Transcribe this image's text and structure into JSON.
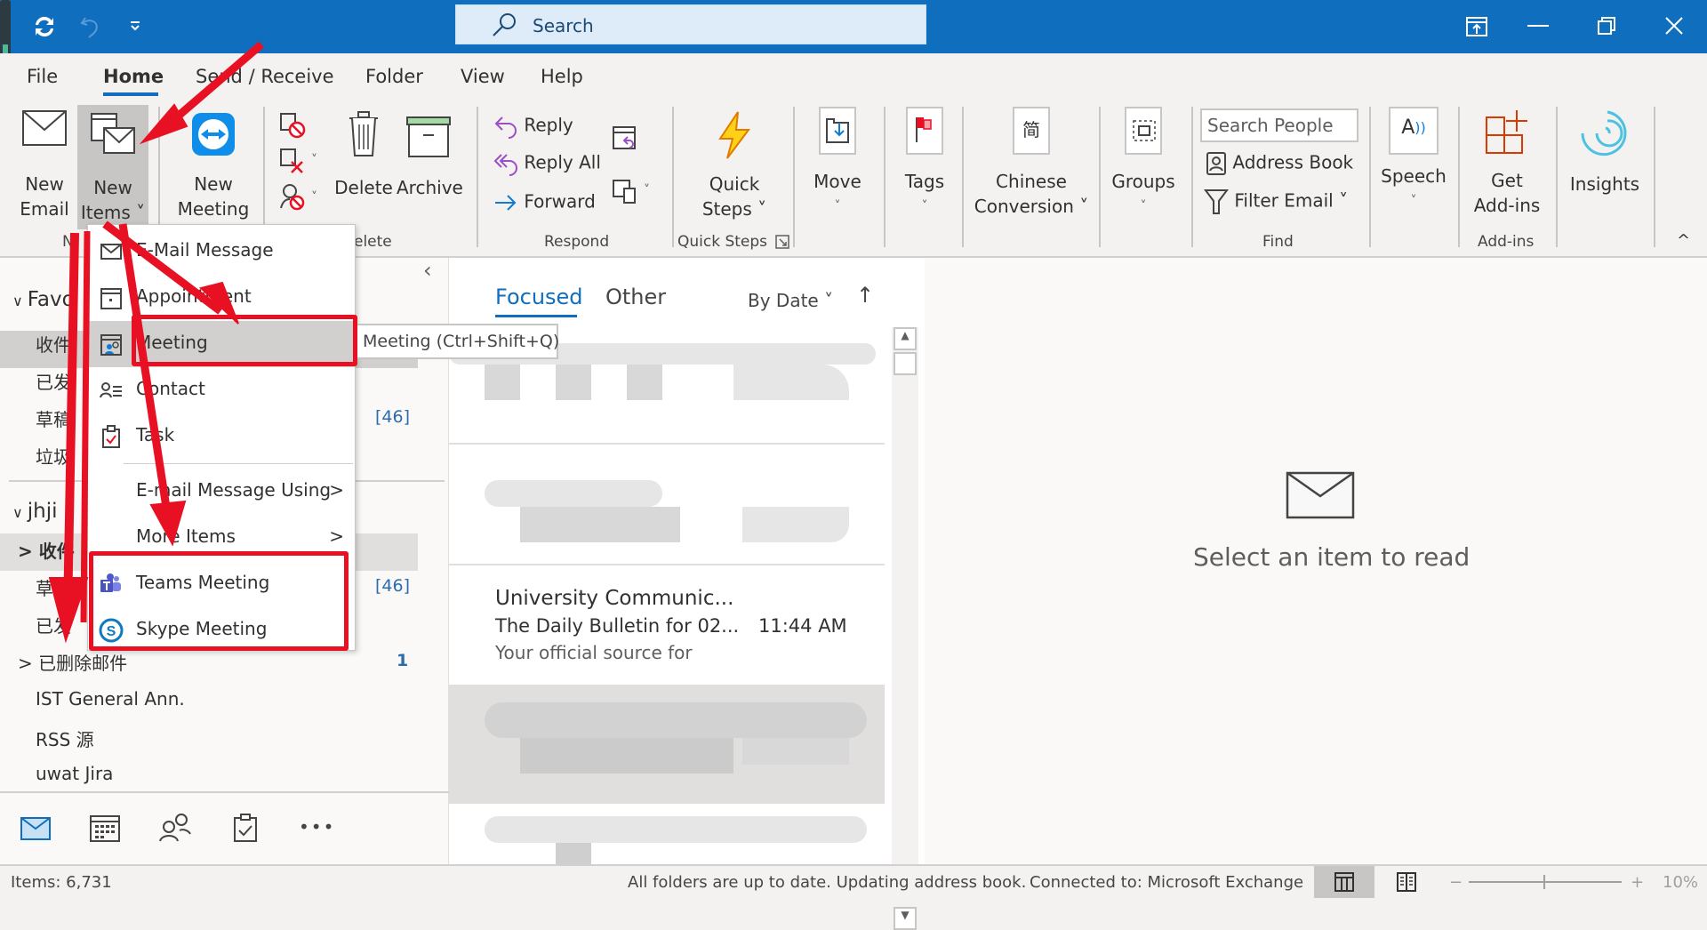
{
  "titlebar": {
    "search_placeholder": "Search",
    "quick_access": [
      "sync-icon",
      "undo-icon",
      "customize-icon"
    ],
    "window_controls": [
      "ribbon-display-icon",
      "minimize-icon",
      "restore-icon",
      "close-icon"
    ]
  },
  "tabs": [
    {
      "label": "File"
    },
    {
      "label": "Home",
      "active": true
    },
    {
      "label": "Send / Receive"
    },
    {
      "label": "Folder"
    },
    {
      "label": "View"
    },
    {
      "label": "Help"
    }
  ],
  "ribbon": {
    "new_email": [
      "New",
      "Email"
    ],
    "new_items": [
      "New",
      "Items ˅"
    ],
    "new_meeting": [
      "New",
      "Meeting"
    ],
    "delete": "Delete",
    "archive": "Archive",
    "reply": "Reply",
    "reply_all": "Reply All",
    "forward": "Forward",
    "quick_steps": [
      "Quick",
      "Steps ˅"
    ],
    "move": "Move",
    "tags": "Tags",
    "chinese_conversion": [
      "Chinese",
      "Conversion ˅"
    ],
    "groups": "Groups",
    "search_people": "Search People",
    "address_book": "Address Book",
    "filter_email": "Filter Email ˅",
    "speech": "Speech",
    "get_addins": [
      "Get",
      "Add-ins"
    ],
    "insights": "Insights",
    "group_labels": {
      "new": "N",
      "delete": "elete",
      "respond": "Respond",
      "quick_steps": "Quick Steps",
      "find": "Find",
      "addins": "Add-ins"
    },
    "chevron_small": "˅",
    "collapse_icon": "^"
  },
  "menu": {
    "items": [
      {
        "label": "E-Mail Message",
        "icon": "email-icon"
      },
      {
        "label": "Appointment",
        "icon": "appointment-icon"
      },
      {
        "label": "Meeting",
        "icon": "meeting-icon",
        "highlighted": true
      },
      {
        "label": "Contact",
        "icon": "contact-icon"
      },
      {
        "label": "Task",
        "icon": "task-icon"
      },
      {
        "label": "E-mail Message Using",
        "submenu": true
      },
      {
        "label": "More Items",
        "submenu": true
      },
      {
        "label": "Teams Meeting",
        "icon": "teams-icon"
      },
      {
        "label": "Skype Meeting",
        "icon": "skype-icon"
      }
    ],
    "tooltip": "Meeting (Ctrl+Shift+Q)",
    "submenu_arrow": ">"
  },
  "folders": {
    "collapse_arrow": "‹",
    "favorites_header": "Favo",
    "favorites": [
      {
        "label": "收件"
      },
      {
        "label": "已发"
      },
      {
        "label": "草稿",
        "count": "[46]"
      },
      {
        "label": "垃圾"
      }
    ],
    "account_header": "jhji",
    "account": [
      {
        "label": "收件",
        "bold": true,
        "expander": ">"
      },
      {
        "label": "草稿",
        "count": "[46]"
      },
      {
        "label": "已发"
      },
      {
        "label": "已删除邮件",
        "count": "1",
        "expander": ">"
      },
      {
        "label": "IST General Ann."
      },
      {
        "label": "RSS 源"
      },
      {
        "label": "uwat Jira"
      }
    ],
    "nav_icons": [
      "mail-icon",
      "calendar-icon",
      "people-icon",
      "tasks-icon",
      "more-icon"
    ],
    "more_label": "•••"
  },
  "message_list": {
    "tabs": [
      {
        "label": "Focused",
        "active": true
      },
      {
        "label": "Other"
      }
    ],
    "sort": "By Date",
    "sort_chevron": "˅",
    "sort_dir": "↑",
    "messages": [
      {
        "sender": "University Communic...",
        "subject": "The Daily Bulletin for 02...",
        "time": "11:44 AM",
        "preview": "Your official source for"
      }
    ]
  },
  "reading_pane": {
    "empty_text": "Select an item to read"
  },
  "status": {
    "items": "Items: 6,731",
    "sync": "All folders are up to date.  Updating address book.",
    "connection": "Connected to: Microsoft Exchange",
    "zoom": "10%",
    "zoom_minus": "−",
    "zoom_plus": "+"
  },
  "colors": {
    "accent": "#106ebe",
    "annotation_red": "#e81123",
    "link_blue": "#2b6cb0"
  }
}
